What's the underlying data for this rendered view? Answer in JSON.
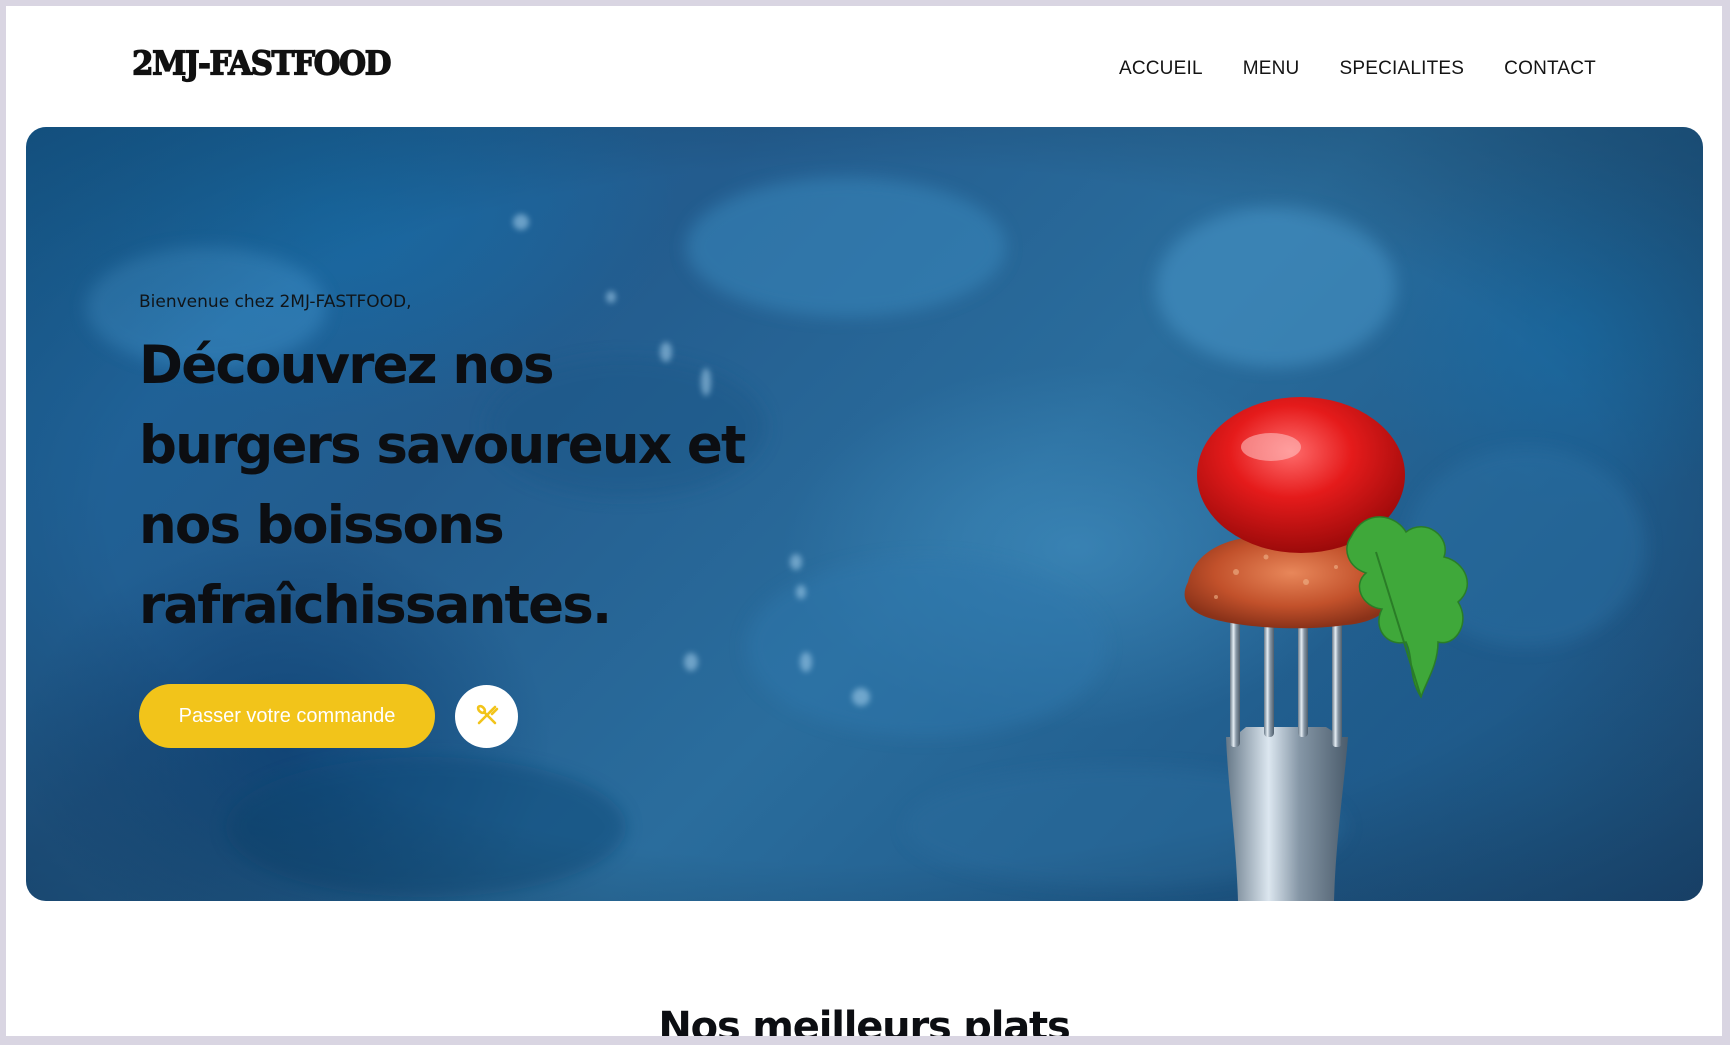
{
  "brand": {
    "logo": "2MJ-FASTFOOD"
  },
  "nav": {
    "items": [
      {
        "label": "ACCUEIL"
      },
      {
        "label": "MENU"
      },
      {
        "label": "SPECIALITES"
      },
      {
        "label": "CONTACT"
      }
    ]
  },
  "hero": {
    "welcome": "Bienvenue chez 2MJ-FASTFOOD,",
    "headline_lines": [
      "Découvrez nos",
      "burgers savoureux et",
      "nos boissons",
      "rafraîchissantes."
    ],
    "cta_label": "Passer votre commande",
    "cta_icon": "utensils-cross-icon",
    "image": "fork-with-tomato-and-chicken"
  },
  "section": {
    "title": "Nos meilleurs plats"
  },
  "colors": {
    "accent": "#f2c41a",
    "text": "#0c0e12",
    "hero_background": "#1f5f92",
    "page_frame": "#d9d5e2"
  }
}
